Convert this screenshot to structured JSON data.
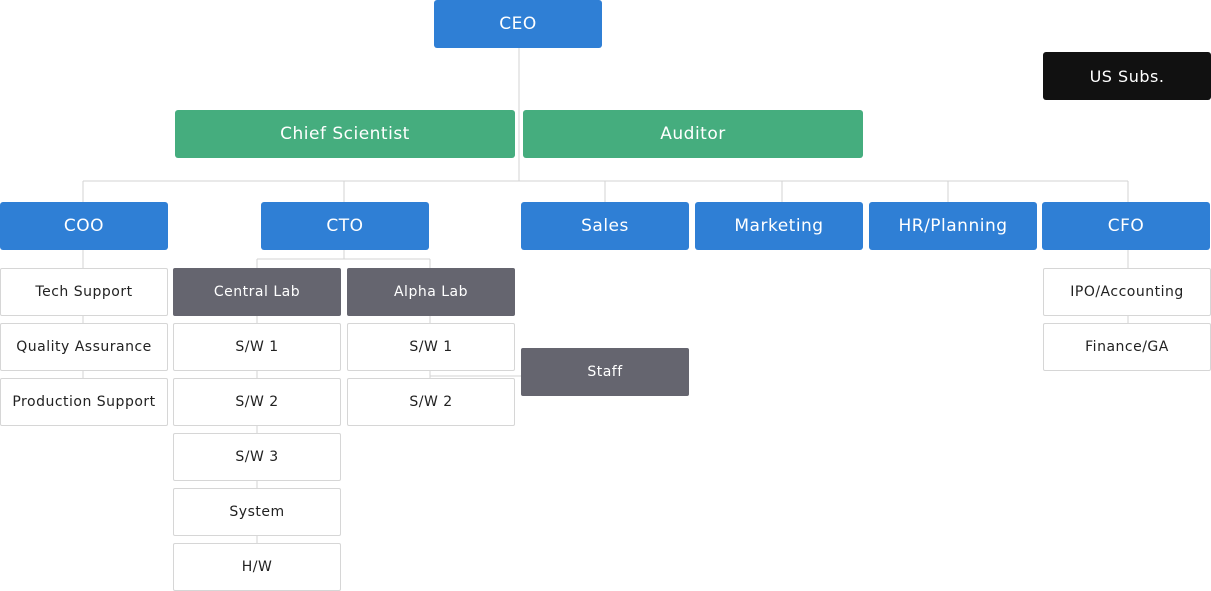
{
  "nodes": {
    "ceo": "CEO",
    "us_subs": "US Subs.",
    "chief_scientist": "Chief Scientist",
    "auditor": "Auditor",
    "coo": "COO",
    "cto": "CTO",
    "sales": "Sales",
    "marketing": "Marketing",
    "hr_planning": "HR/Planning",
    "cfo": "CFO",
    "tech_support": "Tech Support",
    "quality_assurance": "Quality Assurance",
    "production_support": "Production Support",
    "central_lab": "Central Lab",
    "alpha_lab": "Alpha Lab",
    "staff": "Staff",
    "central_sw1": "S/W 1",
    "central_sw2": "S/W 2",
    "central_sw3": "S/W 3",
    "central_system": "System",
    "central_hw": "H/W",
    "alpha_sw1": "S/W 1",
    "alpha_sw2": "S/W 2",
    "ipo_accounting": "IPO/Accounting",
    "finance_ga": "Finance/GA"
  },
  "colors": {
    "executive": "#2f7fd5",
    "advisory": "#45ad7e",
    "subsidiary": "#111111",
    "lab": "#65656f",
    "unit_border": "#d6d6d6",
    "connector": "#d3d3d3"
  }
}
